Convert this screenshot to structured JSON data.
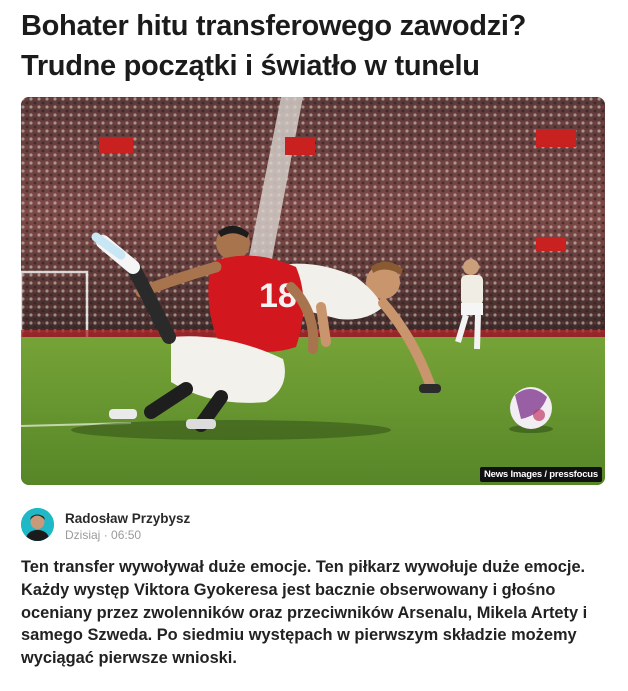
{
  "article": {
    "title": "Bohater hitu transferowego zawodzi? Trudne początki i światło w tunelu",
    "image": {
      "credit": "News Images / pressfocus",
      "jersey_number": "18"
    },
    "author": {
      "name": "Radosław Przybysz",
      "date": "Dzisiaj",
      "time": "06:50"
    },
    "lead": "Ten transfer wywoływał duże emocje. Ten piłkarz wywołuje duże emocje. Każdy występ Viktora Gyokeresa jest bacznie obserwowany i głośno oceniany przez zwolenników oraz przeciwników Arsenalu, Mikela Artety i samego Szweda. Po siedmiu występach w pierwszym składzie możemy wyciągać pierwsze wnioski."
  },
  "colors": {
    "grass": "#5f8f2e",
    "united_red": "#d3171e",
    "arsenal_white": "#f2f0ea",
    "avatar_bg": "#1fb8c7"
  }
}
